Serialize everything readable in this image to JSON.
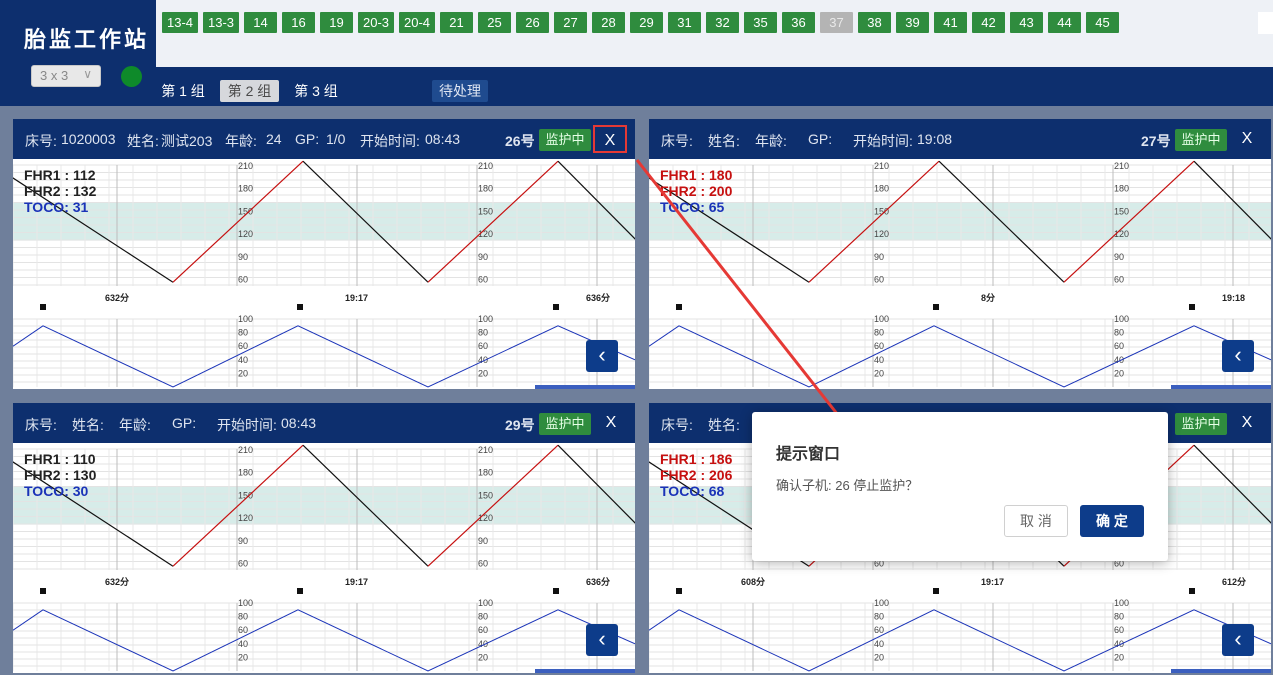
{
  "app": {
    "title": "胎监工作站",
    "layout_select": "3 x 3",
    "status_color": "#0e8a2a"
  },
  "beds": [
    {
      "label": "13-4",
      "enabled": true
    },
    {
      "label": "13-3",
      "enabled": true
    },
    {
      "label": "14",
      "enabled": true
    },
    {
      "label": "16",
      "enabled": true
    },
    {
      "label": "19",
      "enabled": true
    },
    {
      "label": "20-3",
      "enabled": true
    },
    {
      "label": "20-4",
      "enabled": true
    },
    {
      "label": "21",
      "enabled": true
    },
    {
      "label": "25",
      "enabled": true
    },
    {
      "label": "26",
      "enabled": true
    },
    {
      "label": "27",
      "enabled": true
    },
    {
      "label": "28",
      "enabled": true
    },
    {
      "label": "29",
      "enabled": true
    },
    {
      "label": "31",
      "enabled": true
    },
    {
      "label": "32",
      "enabled": true
    },
    {
      "label": "35",
      "enabled": true
    },
    {
      "label": "36",
      "enabled": true
    },
    {
      "label": "37",
      "enabled": false
    },
    {
      "label": "38",
      "enabled": true
    },
    {
      "label": "39",
      "enabled": true
    },
    {
      "label": "41",
      "enabled": true
    },
    {
      "label": "42",
      "enabled": true
    },
    {
      "label": "43",
      "enabled": true
    },
    {
      "label": "44",
      "enabled": true
    },
    {
      "label": "45",
      "enabled": true
    }
  ],
  "groups": [
    {
      "label": "第 1 组",
      "active": false
    },
    {
      "label": "第 2 组",
      "active": true
    },
    {
      "label": "第 3 组",
      "active": false
    }
  ],
  "pending_label": "待处理",
  "panels": [
    {
      "bed_label": "床号:",
      "bed_value": "1020003",
      "name_label": "姓名:",
      "name_value": "测试203",
      "age_label": "年龄:",
      "age_value": "24",
      "gp_label": "GP:",
      "gp_value": "1/0",
      "start_label": "开始时间:",
      "start_value": "08:43",
      "bed_no": "26号",
      "status": "监护中",
      "close": "X",
      "fhr1": "FHR1 : 112",
      "fhr2": "FHR2 : 132",
      "toco": "TOCO: 31",
      "time_labels": [
        "632分",
        "19:17",
        "636分"
      ],
      "readout_red": false
    },
    {
      "bed_label": "床号:",
      "bed_value": "",
      "name_label": "姓名:",
      "name_value": "",
      "age_label": "年龄:",
      "age_value": "",
      "gp_label": "GP:",
      "gp_value": "",
      "start_label": "开始时间:",
      "start_value": "19:08",
      "bed_no": "27号",
      "status": "监护中",
      "close": "X",
      "fhr1": "FHR1 : 180",
      "fhr2": "FHR2 : 200",
      "toco": "TOCO: 65",
      "time_labels": [
        "",
        "8分",
        "19:18"
      ],
      "readout_red": true
    },
    {
      "bed_label": "床号:",
      "bed_value": "",
      "name_label": "姓名:",
      "name_value": "",
      "age_label": "年龄:",
      "age_value": "",
      "gp_label": "GP:",
      "gp_value": "",
      "start_label": "开始时间:",
      "start_value": "08:43",
      "bed_no": "29号",
      "status": "监护中",
      "close": "X",
      "fhr1": "FHR1 : 110",
      "fhr2": "FHR2 : 130",
      "toco": "TOCO: 30",
      "time_labels": [
        "632分",
        "19:17",
        "636分"
      ],
      "readout_red": false
    },
    {
      "bed_label": "床号:",
      "bed_value": "",
      "name_label": "姓名:",
      "name_value": "",
      "age_label": "",
      "age_value": "",
      "gp_label": "",
      "gp_value": "",
      "start_label": "",
      "start_value": "",
      "bed_no": "",
      "status": "监护中",
      "close": "X",
      "fhr1": "FHR1 : 186",
      "fhr2": "FHR2 : 206",
      "toco": "TOCO: 68",
      "time_labels": [
        "608分",
        "19:17",
        "612分"
      ],
      "readout_red": true
    }
  ],
  "chart_axes": {
    "fhr_ticks": [
      "210",
      "180",
      "150",
      "120",
      "90",
      "60"
    ],
    "toco_ticks": [
      "100",
      "80",
      "60",
      "40",
      "20"
    ]
  },
  "dialog": {
    "title": "提示窗口",
    "message": "确认子机: 26 停止监护？",
    "cancel": "取 消",
    "ok": "确 定"
  },
  "colors": {
    "header": "#0d2f6e",
    "monitor_green": "#2f8c3e",
    "fhr_red": "#c61010",
    "toco_blue": "#1a33b8",
    "annotation_red": "#e53935"
  }
}
